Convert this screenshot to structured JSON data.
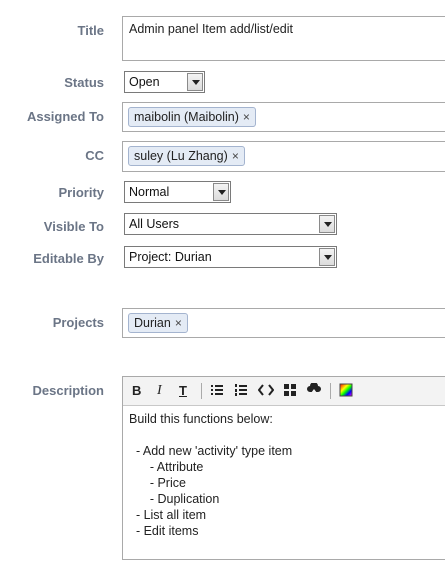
{
  "labels": {
    "title": "Title",
    "status": "Status",
    "assigned_to": "Assigned To",
    "cc": "CC",
    "priority": "Priority",
    "visible_to": "Visible To",
    "editable_by": "Editable By",
    "projects": "Projects",
    "description": "Description"
  },
  "fields": {
    "title": "Admin panel Item add/list/edit",
    "status": "Open",
    "assigned_to": "maibolin (Maibolin)",
    "cc": "suley (Lu Zhang)",
    "priority": "Normal",
    "visible_to": "All Users",
    "editable_by": "Project: Durian",
    "projects": "Durian",
    "remove_glyph": "×"
  },
  "toolbar": {
    "bold": "B",
    "italic": "I",
    "strike": "T"
  },
  "description": {
    "text": "Build this functions below:\n\n  - Add new 'activity' type item\n      - Attribute\n      - Price\n      - Duplication\n  - List all item\n  - Edit items"
  },
  "colors": {
    "label": "#6b7586",
    "tag_bg": "#e4ebf5",
    "tag_border": "#a4b4cf"
  }
}
